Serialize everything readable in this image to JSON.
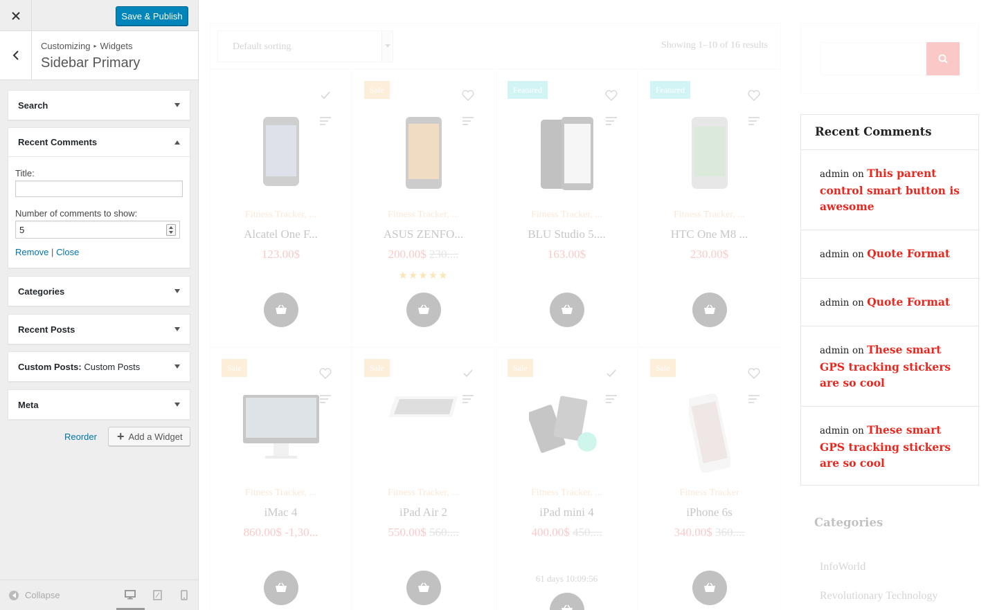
{
  "customizer": {
    "close_icon": "close-icon",
    "save_label": "Save & Publish",
    "breadcrumb": {
      "root": "Customizing",
      "section": "Widgets"
    },
    "section_title": "Sidebar Primary",
    "widgets": [
      {
        "title": "Search"
      },
      {
        "title": "Recent Comments",
        "expanded": true
      },
      {
        "title": "Categories"
      },
      {
        "title": "Recent Posts"
      },
      {
        "title": "Custom Posts:",
        "subtitle": "Custom Posts"
      },
      {
        "title": "Meta"
      }
    ],
    "recent_comments_form": {
      "title_label": "Title:",
      "title_value": "",
      "count_label": "Number of comments to show:",
      "count_value": "5",
      "remove_label": "Remove",
      "separator": "|",
      "close_label": "Close"
    },
    "reorder_label": "Reorder",
    "add_widget_label": "Add a Widget",
    "collapse_label": "Collapse",
    "accent_color": "#0085ba"
  },
  "preview": {
    "sorting": "Default sorting",
    "results_text": "Showing 1–10 of 16 results",
    "products": [
      {
        "badge": "",
        "category": "Fitness Tracker, ...",
        "name": "Alcatel One F...",
        "price": "123.00$",
        "old_price": "",
        "stars": "",
        "compare_icon": "check-icon"
      },
      {
        "badge": "Sale",
        "category": "Fitness Tracker, ...",
        "name": "ASUS ZENFO...",
        "price": "200.00$",
        "old_price": "230....",
        "stars": "★★★★★",
        "compare_icon": "heart-icon"
      },
      {
        "badge": "Featured",
        "category": "Fitness Tracker, ...",
        "name": "BLU Studio 5....",
        "price": "163.00$",
        "old_price": "",
        "stars": "",
        "compare_icon": "heart-icon"
      },
      {
        "badge": "Featured",
        "category": "Fitness Tracker, ...",
        "name": "HTC One M8 ...",
        "price": "230.00$",
        "old_price": "",
        "stars": "",
        "compare_icon": "heart-icon"
      },
      {
        "badge": "Sale",
        "category": "Fitness Tracker, ...",
        "name": "iMac 4",
        "price": "860.00$ -1,30...",
        "old_price": "",
        "stars": "",
        "compare_icon": "heart-icon"
      },
      {
        "badge": "Sale",
        "category": "Fitness Tracker, ...",
        "name": "iPad Air 2",
        "price": "550.00$",
        "old_price": "560....",
        "stars": "",
        "compare_icon": "check-icon"
      },
      {
        "badge": "Sale",
        "category": "Fitness Tracker, ...",
        "name": "iPad mini 4",
        "price": "400.00$",
        "old_price": "450....",
        "stars": "",
        "compare_icon": "check-icon",
        "timer": "61 days 10:09:56"
      },
      {
        "badge": "Sale",
        "category": "Fitness Tracker",
        "name": "iPhone 6s",
        "price": "340.00$",
        "old_price": "360....",
        "stars": "",
        "compare_icon": "heart-icon"
      }
    ],
    "recent_comments": {
      "title": "Recent Comments",
      "items": [
        {
          "author": "admin",
          "on": "on",
          "post": "This parent control smart button is awesome"
        },
        {
          "author": "admin",
          "on": "on",
          "post": "Quote Format"
        },
        {
          "author": "admin",
          "on": "on",
          "post": "Quote Format"
        },
        {
          "author": "admin",
          "on": "on",
          "post": "These smart GPS tracking stickers are so cool"
        },
        {
          "author": "admin",
          "on": "on",
          "post": "These smart GPS tracking stickers are so cool"
        }
      ]
    },
    "categories_title": "Categories",
    "categories": [
      "InfoWorld",
      "Revolutionary Technology"
    ],
    "link_color": "#e8281f"
  }
}
